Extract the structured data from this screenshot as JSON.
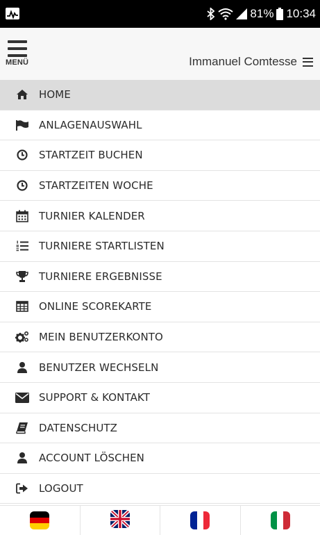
{
  "status_bar": {
    "battery_percent": "81%",
    "time": "10:34"
  },
  "header": {
    "menu_label": "MENÜ",
    "user_name": "Immanuel Comtesse"
  },
  "menu": {
    "items": [
      {
        "label": "HOME",
        "icon": "home-icon",
        "active": true
      },
      {
        "label": "ANLAGENAUSWAHL",
        "icon": "flag-icon"
      },
      {
        "label": "STARTZEIT BUCHEN",
        "icon": "clock-icon"
      },
      {
        "label": "STARTZEITEN WOCHE",
        "icon": "clock-icon"
      },
      {
        "label": "TURNIER KALENDER",
        "icon": "calendar-icon"
      },
      {
        "label": "TURNIERE STARTLISTEN",
        "icon": "ordered-list-icon"
      },
      {
        "label": "TURNIERE ERGEBNISSE",
        "icon": "trophy-icon"
      },
      {
        "label": "ONLINE SCOREKARTE",
        "icon": "table-icon"
      },
      {
        "label": "MEIN BENUTZERKONTO",
        "icon": "gears-icon"
      },
      {
        "label": "BENUTZER WECHSELN",
        "icon": "user-icon"
      },
      {
        "label": "SUPPORT & KONTAKT",
        "icon": "envelope-icon"
      },
      {
        "label": "DATENSCHUTZ",
        "icon": "book-icon"
      },
      {
        "label": "ACCOUNT LÖSCHEN",
        "icon": "user-icon"
      },
      {
        "label": "LOGOUT",
        "icon": "sign-out-icon"
      }
    ]
  },
  "languages": [
    {
      "code": "de",
      "icon": "german-flag-icon"
    },
    {
      "code": "en",
      "icon": "uk-flag-icon"
    },
    {
      "code": "fr",
      "icon": "french-flag-icon"
    },
    {
      "code": "it",
      "icon": "italian-flag-icon"
    }
  ],
  "colors": {
    "active_item_bg": "#dcdcdc",
    "header_bg": "#f7f7f7",
    "icon": "#2b2b2b"
  }
}
